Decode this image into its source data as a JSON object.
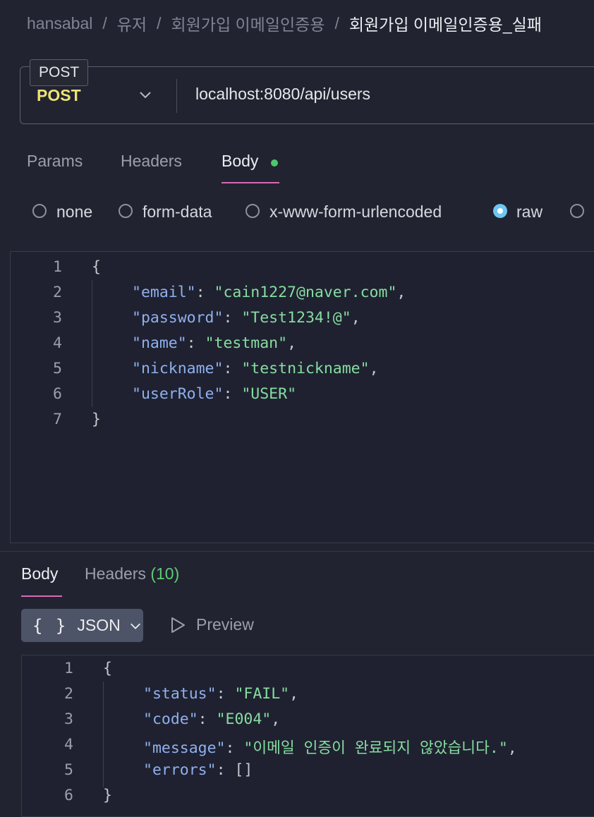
{
  "breadcrumb": {
    "items": [
      "hansabal",
      "유저",
      "회원가입 이메일인증용"
    ],
    "separator": "/",
    "current": "회원가입 이메일인증용_실패"
  },
  "request": {
    "tooltip": "POST",
    "method": "POST",
    "url": "localhost:8080/api/users"
  },
  "request_tabs": [
    {
      "label": "Params"
    },
    {
      "label": "Headers"
    },
    {
      "label": "Body",
      "active": true,
      "indicator_color": "#4fc66a"
    }
  ],
  "body_types": [
    {
      "label": "none",
      "checked": false
    },
    {
      "label": "form-data",
      "checked": false
    },
    {
      "label": "x-www-form-urlencoded",
      "checked": false
    },
    {
      "label": "raw",
      "checked": true
    }
  ],
  "request_body": {
    "line_numbers": [
      "1",
      "2",
      "3",
      "4",
      "5",
      "6",
      "7"
    ],
    "open_brace": "{",
    "close_brace": "}",
    "fields": [
      {
        "key": "\"email\"",
        "value": "\"cain1227@naver.com\"",
        "comma": ","
      },
      {
        "key": "\"password\"",
        "value": "\"Test1234!@\"",
        "comma": ","
      },
      {
        "key": "\"name\"",
        "value": "\"testman\"",
        "comma": ","
      },
      {
        "key": "\"nickname\"",
        "value": "\"testnickname\"",
        "comma": ","
      },
      {
        "key": "\"userRole\"",
        "value": "\"USER\"",
        "comma": ""
      }
    ]
  },
  "response_tabs": {
    "body_label": "Body",
    "headers_label": "Headers",
    "headers_count": "(10)"
  },
  "response_view": {
    "format_icon": "{ }",
    "format_label": "JSON",
    "preview_label": "Preview"
  },
  "response_body": {
    "line_numbers": [
      "1",
      "2",
      "3",
      "4",
      "5",
      "6"
    ],
    "open_brace": "{",
    "close_brace": "}",
    "fields": [
      {
        "key": "\"status\"",
        "value": "\"FAIL\"",
        "comma": ","
      },
      {
        "key": "\"code\"",
        "value": "\"E004\"",
        "comma": ","
      },
      {
        "key": "\"message\"",
        "value": "\"이메일 인증이 완료되지 않았습니다.\"",
        "comma": ","
      },
      {
        "key": "\"errors\"",
        "value": "[]",
        "comma": ""
      }
    ]
  },
  "colors": {
    "background": "#212331",
    "method": "#eee373",
    "json_key": "#8fb0ee",
    "json_string": "#86dda1",
    "active_underline": "#d869b4",
    "radio_checked": "#6ec6f1",
    "count": "#5fcc73"
  }
}
